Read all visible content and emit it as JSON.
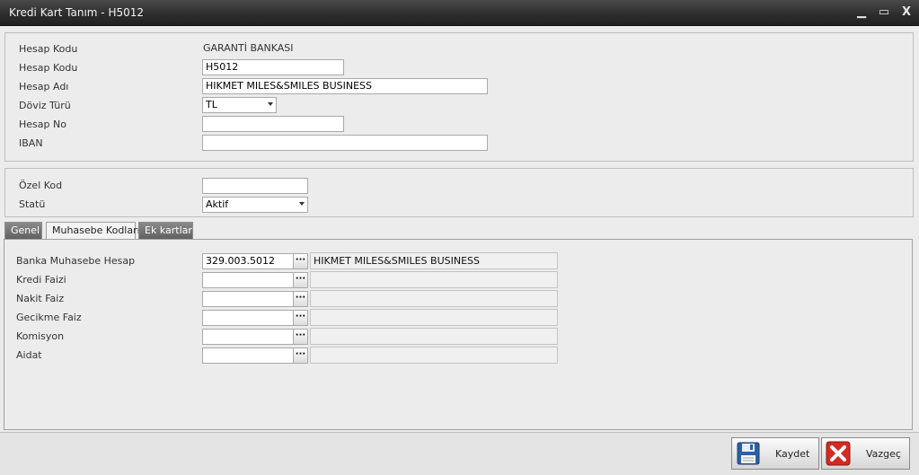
{
  "window": {
    "title": "Kredi Kart Tanım - H5012",
    "minimize_glyph": "▁",
    "maximize_glyph": "▭",
    "close_glyph": "X"
  },
  "general": {
    "bank_label": "Hesap Kodu",
    "bank_value": "GARANTİ BANKASI",
    "code_label": "Hesap Kodu",
    "code_value": "H5012",
    "name_label": "Hesap Adı",
    "name_value": "HIKMET MILES&SMILES BUSINESS",
    "currency_label": "Döviz Türü",
    "currency_value": "TL",
    "account_no_label": "Hesap No",
    "account_no_value": "",
    "iban_label": "IBAN",
    "iban_value": ""
  },
  "extra": {
    "special_code_label": "Özel Kod",
    "special_code_value": "",
    "status_label": "Statü",
    "status_value": "Aktif"
  },
  "tabs": [
    {
      "label": "Genel",
      "active": false
    },
    {
      "label": "Muhasebe Kodları",
      "active": true
    },
    {
      "label": "Ek kartlar",
      "active": false
    }
  ],
  "accounting": {
    "ellipsis": "···",
    "rows": [
      {
        "label": "Banka Muhasebe Hesap",
        "code": "329.003.5012",
        "description": "HIKMET MILES&SMILES BUSINESS"
      },
      {
        "label": "Kredi Faizi",
        "code": "",
        "description": ""
      },
      {
        "label": "Nakit Faiz",
        "code": "",
        "description": ""
      },
      {
        "label": "Gecikme Faiz",
        "code": "",
        "description": ""
      },
      {
        "label": "Komisyon",
        "code": "",
        "description": ""
      },
      {
        "label": "Aidat",
        "code": "",
        "description": ""
      }
    ]
  },
  "buttons": {
    "save_label": "Kaydet",
    "cancel_label": "Vazgeç"
  },
  "colors": {
    "title_bar": "#2c2c2c",
    "save_icon": "#2d5fa6",
    "cancel_icon": "#d42a1f"
  }
}
